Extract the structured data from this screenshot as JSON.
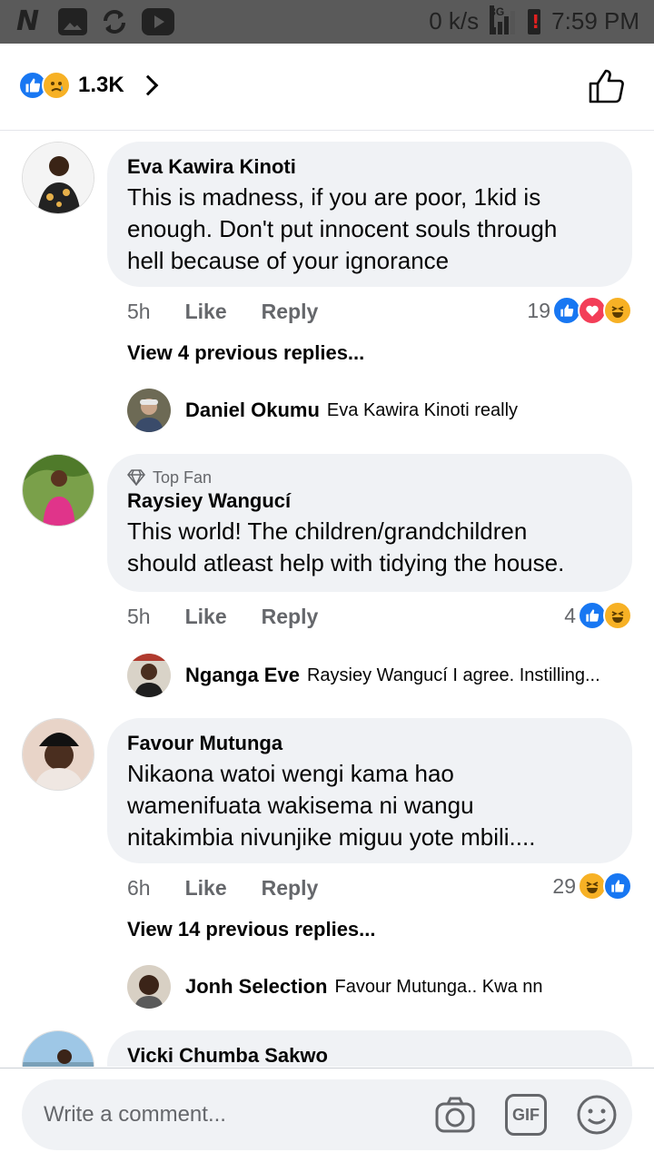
{
  "status_bar": {
    "speed": "0 k/s",
    "network": "3G",
    "time": "7:59 PM",
    "icons": [
      "n-app-icon",
      "image-icon",
      "sync-icon",
      "youtube-icon"
    ]
  },
  "header": {
    "reaction_icons": [
      "like",
      "sad"
    ],
    "reaction_count": "1.3K"
  },
  "comments": [
    {
      "author": "Eva Kawira Kinoti",
      "top_fan": false,
      "lines": [
        "This is madness, if you are poor, 1kid is",
        "enough. Don't put innocent souls through",
        "hell because of your ignorance"
      ],
      "time": "5h",
      "like": "Like",
      "reply": "Reply",
      "reaction_count": "19",
      "reactions": [
        "like",
        "love",
        "haha"
      ],
      "view_previous": "View 4 previous replies...",
      "preview_reply": {
        "author": "Daniel Okumu",
        "text": "Eva Kawira Kinoti really"
      }
    },
    {
      "author": "Raysiey Wangucí",
      "top_fan": true,
      "top_fan_label": "Top Fan",
      "lines": [
        "This world! The children/grandchildren",
        "should atleast  help with tidying the house."
      ],
      "time": "5h",
      "like": "Like",
      "reply": "Reply",
      "reaction_count": "4",
      "reactions": [
        "like",
        "haha"
      ],
      "preview_reply": {
        "author": "Nganga Eve",
        "text": "Raysiey Wangucí I agree. Instilling..."
      }
    },
    {
      "author": "Favour Mutunga",
      "top_fan": false,
      "lines": [
        "Nikaona watoi wengi kama hao",
        "wamenifuata wakisema ni wangu",
        "nitakimbia nivunjike miguu yote mbili...."
      ],
      "time": "6h",
      "like": "Like",
      "reply": "Reply",
      "reaction_count": "29",
      "reactions": [
        "haha",
        "like"
      ],
      "view_previous": "View 14 previous replies...",
      "preview_reply": {
        "author": "Jonh Selection",
        "text": "Favour Mutunga.. Kwa nn"
      }
    },
    {
      "author": "Vicki Chumba Sakwo"
    }
  ],
  "composer": {
    "placeholder": "Write a comment...",
    "icons": [
      "camera-icon",
      "gif-icon",
      "sticker-icon"
    ],
    "gif_label": "GIF"
  },
  "colors": {
    "accent": "#1877f2",
    "bubble": "#f0f2f5",
    "secondary_text": "#65676b"
  }
}
